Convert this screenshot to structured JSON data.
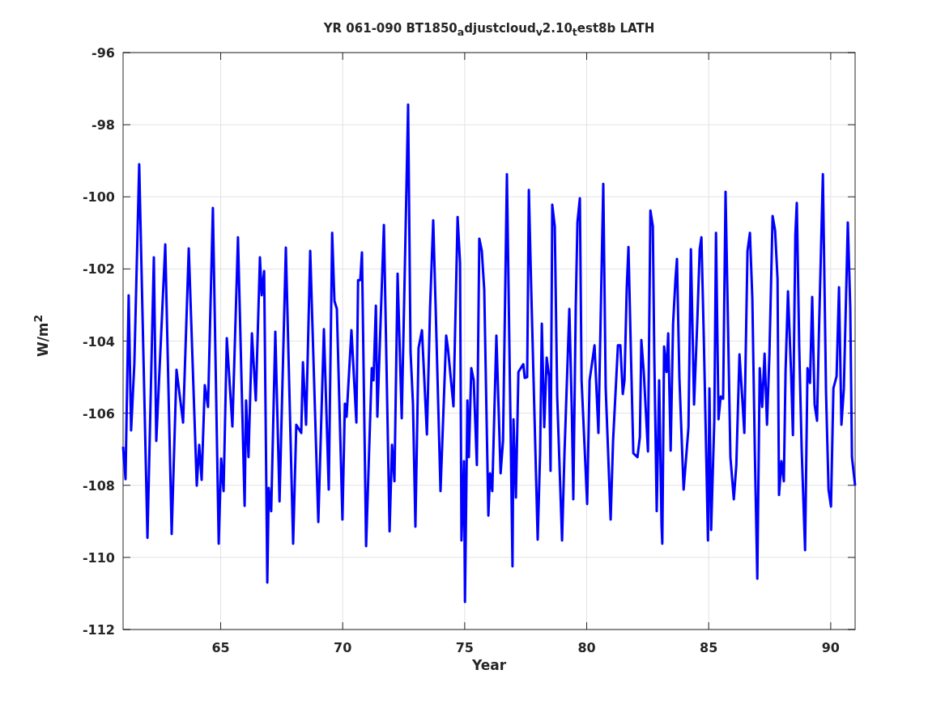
{
  "figure": {
    "chart_data": {
      "type": "line",
      "title": "YR 061-090 BT1850$_{a}$djustcloud$_{v}$2.10$_{t}$est8b LATH",
      "xlabel": "Year",
      "ylabel": "W/m$^{2}$",
      "grid": true,
      "xlim": [
        61,
        91
      ],
      "ylim": [
        -112,
        -96
      ],
      "xticks": [
        65,
        70,
        75,
        80,
        85,
        90
      ],
      "yticks": [
        -112,
        -110,
        -108,
        -106,
        -104,
        -102,
        -100,
        -98,
        -96
      ],
      "x": [
        61.0,
        61.1,
        61.23,
        61.33,
        61.46,
        61.66,
        62.0,
        62.26,
        62.36,
        62.73,
        62.99,
        63.19,
        63.46,
        63.69,
        64.02,
        64.12,
        64.22,
        64.35,
        64.48,
        64.68,
        64.92,
        65.02,
        65.12,
        65.25,
        65.48,
        65.71,
        65.98,
        66.04,
        66.14,
        66.28,
        66.44,
        66.61,
        66.68,
        66.78,
        66.91,
        66.97,
        67.07,
        67.24,
        67.41,
        67.67,
        67.97,
        68.1,
        68.3,
        68.37,
        68.5,
        68.67,
        69.0,
        69.23,
        69.43,
        69.57,
        69.66,
        69.76,
        69.99,
        70.09,
        70.16,
        70.36,
        70.56,
        70.63,
        70.72,
        70.79,
        70.96,
        71.19,
        71.26,
        71.36,
        71.42,
        71.69,
        71.92,
        72.02,
        72.12,
        72.25,
        72.42,
        72.52,
        72.68,
        72.78,
        72.88,
        72.98,
        73.11,
        73.25,
        73.45,
        73.58,
        73.71,
        73.81,
        74.01,
        74.11,
        74.24,
        74.31,
        74.54,
        74.71,
        74.81,
        74.87,
        74.97,
        75.01,
        75.11,
        75.17,
        75.27,
        75.37,
        75.5,
        75.6,
        75.7,
        75.8,
        75.97,
        76.04,
        76.13,
        76.3,
        76.47,
        76.57,
        76.73,
        76.9,
        76.96,
        77.0,
        77.1,
        77.2,
        77.4,
        77.46,
        77.56,
        77.63,
        77.73,
        77.99,
        78.09,
        78.16,
        78.26,
        78.36,
        78.46,
        78.52,
        78.59,
        78.69,
        78.79,
        78.99,
        79.09,
        79.29,
        79.39,
        79.45,
        79.55,
        79.62,
        79.72,
        79.79,
        80.02,
        80.12,
        80.32,
        80.48,
        80.68,
        80.78,
        80.98,
        81.08,
        81.28,
        81.38,
        81.48,
        81.55,
        81.64,
        81.71,
        81.81,
        81.91,
        82.08,
        82.18,
        82.24,
        82.34,
        82.51,
        82.61,
        82.71,
        82.77,
        82.87,
        82.97,
        83.07,
        83.1,
        83.17,
        83.27,
        83.34,
        83.44,
        83.54,
        83.64,
        83.7,
        83.8,
        83.97,
        84.07,
        84.17,
        84.27,
        84.4,
        84.53,
        84.63,
        84.7,
        84.8,
        84.97,
        85.03,
        85.1,
        85.23,
        85.3,
        85.4,
        85.49,
        85.59,
        85.69,
        85.79,
        85.89,
        86.03,
        86.13,
        86.26,
        86.36,
        86.46,
        86.59,
        86.69,
        86.79,
        86.89,
        86.99,
        87.09,
        87.19,
        87.29,
        87.39,
        87.49,
        87.62,
        87.72,
        87.82,
        87.88,
        87.98,
        88.08,
        88.15,
        88.25,
        88.38,
        88.45,
        88.55,
        88.61,
        88.71,
        88.81,
        88.95,
        89.05,
        89.15,
        89.24,
        89.34,
        89.44,
        89.51,
        89.68,
        89.81,
        89.91,
        90.01,
        90.11,
        90.24,
        90.34,
        90.44,
        90.54,
        90.7,
        90.8,
        90.87,
        91.0
      ],
      "series": [
        {
          "color": "#0000ff",
          "values": [
            -106.93,
            -107.83,
            -102.73,
            -106.48,
            -104.64,
            -99.1,
            -109.46,
            -101.68,
            -106.77,
            -101.32,
            -109.35,
            -104.8,
            -106.26,
            -101.43,
            -108.01,
            -106.88,
            -107.85,
            -105.22,
            -105.83,
            -100.31,
            -109.62,
            -107.26,
            -108.16,
            -103.92,
            -106.37,
            -101.12,
            -108.57,
            -105.65,
            -107.22,
            -103.79,
            -105.65,
            -101.68,
            -102.73,
            -102.06,
            -110.7,
            -108.07,
            -108.72,
            -103.74,
            -108.45,
            -101.41,
            -109.62,
            -106.32,
            -106.55,
            -104.59,
            -106.32,
            -101.5,
            -109.02,
            -103.67,
            -108.12,
            -101.0,
            -102.89,
            -103.11,
            -108.95,
            -105.74,
            -106.1,
            -103.7,
            -106.26,
            -102.31,
            -102.31,
            -101.54,
            -109.69,
            -104.75,
            -105.09,
            -103.02,
            -106.1,
            -100.78,
            -109.28,
            -106.88,
            -107.89,
            -102.13,
            -106.14,
            -102.91,
            -97.44,
            -104.3,
            -105.76,
            -109.15,
            -104.19,
            -103.7,
            -106.59,
            -103.07,
            -100.65,
            -103.07,
            -108.16,
            -106.32,
            -103.85,
            -104.19,
            -105.81,
            -100.56,
            -101.83,
            -109.53,
            -107.33,
            -111.24,
            -105.65,
            -107.22,
            -104.75,
            -105.09,
            -107.44,
            -101.16,
            -101.5,
            -102.58,
            -108.84,
            -107.67,
            -108.16,
            -103.85,
            -107.67,
            -106.77,
            -99.37,
            -107.33,
            -110.25,
            -106.17,
            -108.34,
            -104.86,
            -104.64,
            -105.02,
            -105.0,
            -99.81,
            -102.62,
            -109.51,
            -107.11,
            -103.52,
            -106.39,
            -104.46,
            -104.98,
            -107.6,
            -100.22,
            -100.82,
            -105.54,
            -109.53,
            -107.11,
            -103.11,
            -105.99,
            -108.39,
            -103.07,
            -100.71,
            -100.04,
            -105.09,
            -108.52,
            -105.09,
            -104.12,
            -106.55,
            -99.64,
            -105.31,
            -108.95,
            -106.77,
            -104.12,
            -104.12,
            -105.47,
            -105.09,
            -102.51,
            -101.39,
            -104.3,
            -107.11,
            -107.22,
            -106.66,
            -103.97,
            -104.86,
            -107.06,
            -100.38,
            -100.82,
            -104.42,
            -108.72,
            -105.09,
            -109.13,
            -109.62,
            -104.15,
            -104.86,
            -103.79,
            -107.04,
            -103.52,
            -102.28,
            -101.72,
            -105.02,
            -108.12,
            -107.26,
            -106.39,
            -101.45,
            -105.76,
            -103.52,
            -101.45,
            -101.12,
            -103.97,
            -109.53,
            -105.31,
            -109.24,
            -106.21,
            -101.0,
            -106.17,
            -105.54,
            -105.6,
            -99.86,
            -103.52,
            -107.22,
            -108.39,
            -107.44,
            -104.37,
            -105.43,
            -106.55,
            -101.5,
            -101.0,
            -102.84,
            -107.11,
            -110.59,
            -104.75,
            -105.83,
            -104.35,
            -106.32,
            -104.35,
            -100.53,
            -100.94,
            -102.28,
            -108.27,
            -107.33,
            -107.89,
            -104.82,
            -102.62,
            -104.98,
            -106.61,
            -101.05,
            -100.17,
            -104.19,
            -107.0,
            -109.8,
            -104.75,
            -105.16,
            -102.78,
            -105.76,
            -106.21,
            -103.97,
            -99.37,
            -105.43,
            -108.12,
            -108.59,
            -105.31,
            -104.98,
            -102.51,
            -106.32,
            -105.31,
            -100.71,
            -103.07,
            -107.22,
            -108.01
          ]
        }
      ]
    }
  }
}
